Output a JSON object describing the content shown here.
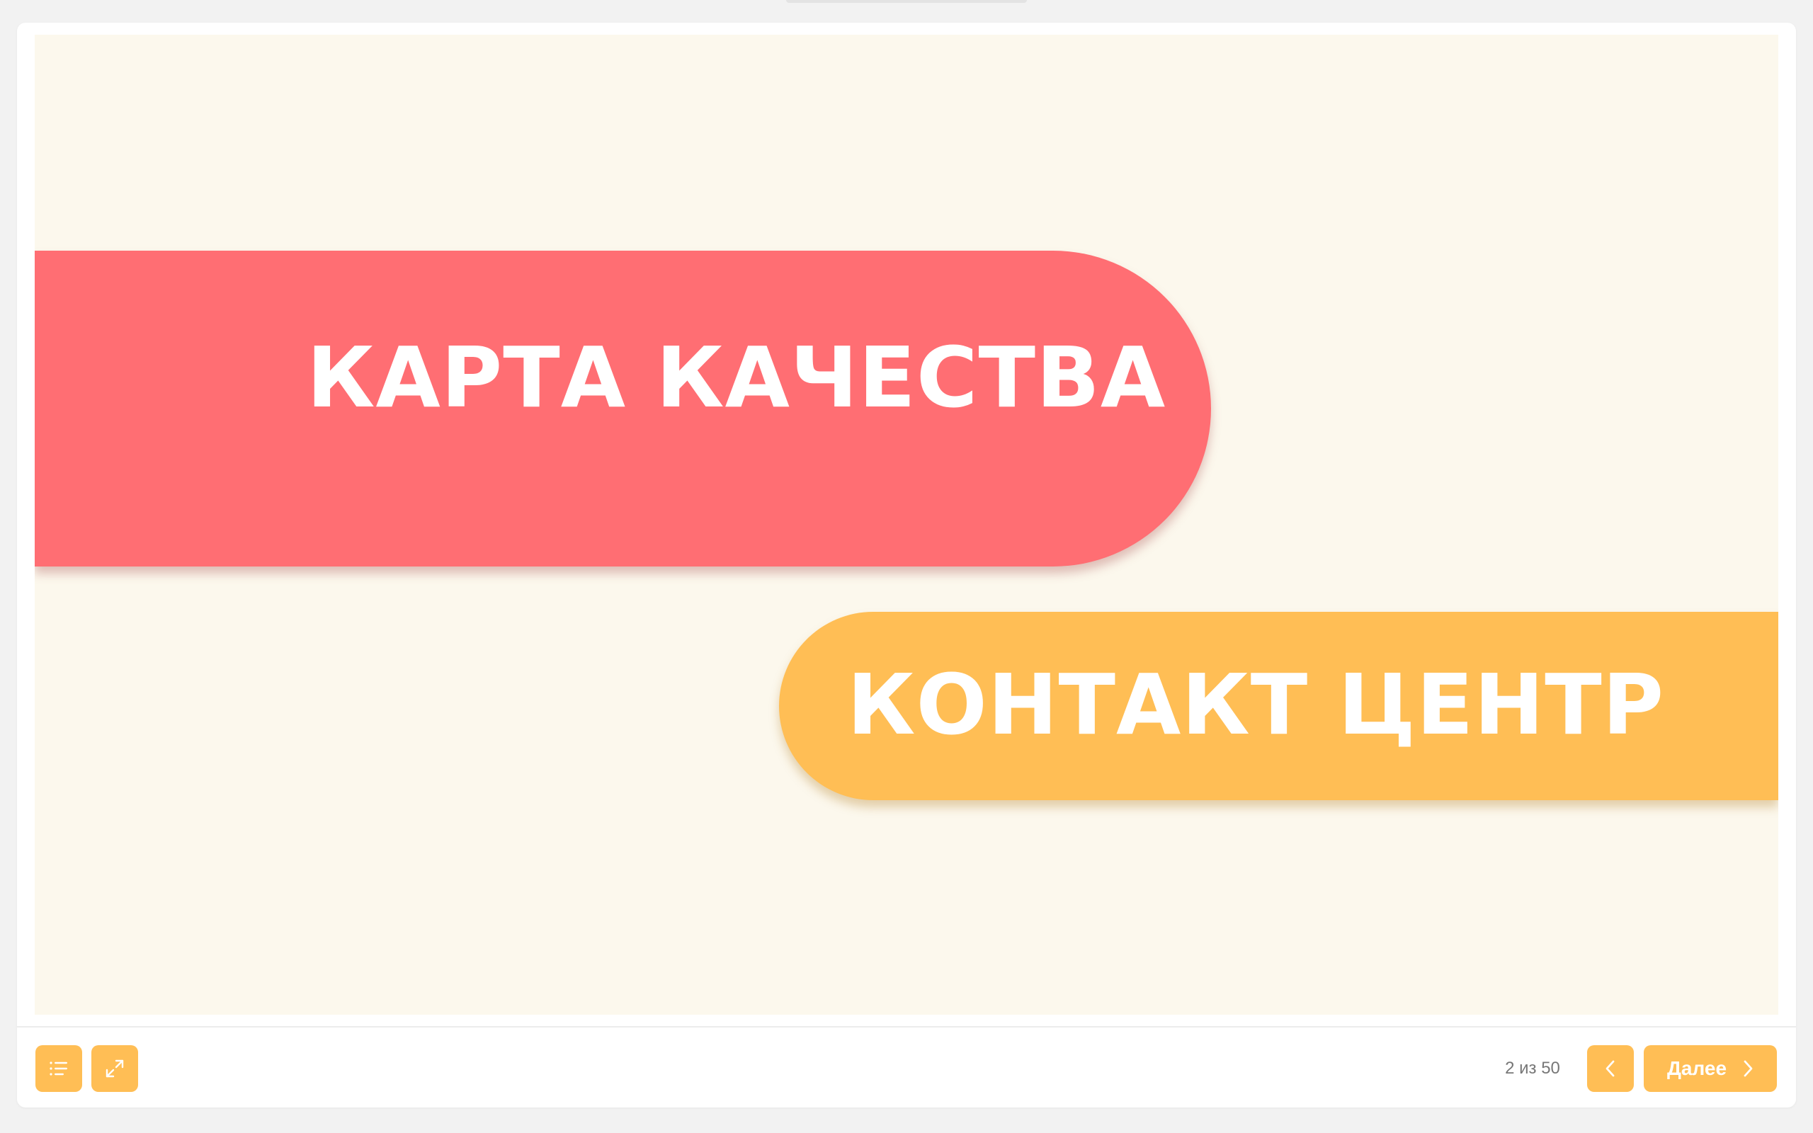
{
  "slide": {
    "title": "КАРТА КАЧЕСТВА",
    "subtitle": "КОНТАКТ ЦЕНТР",
    "colors": {
      "background": "#fcf8ed",
      "title_band": "#ff6e73",
      "subtitle_band": "#ffbe55",
      "text": "#ffffff"
    }
  },
  "controls": {
    "toc_icon": "list-icon",
    "fullscreen_icon": "expand-icon",
    "prev_icon": "chevron-left-icon",
    "next_icon": "chevron-right-icon",
    "accent": "#ffbe55"
  },
  "pager": {
    "counter": "2 из 50",
    "next_label": "Далее"
  }
}
